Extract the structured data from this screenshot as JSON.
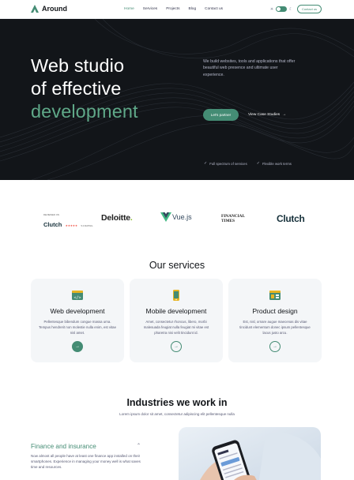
{
  "nav": {
    "logo": "Around",
    "items": [
      "Home",
      "Services",
      "Projects",
      "Blog",
      "Contact us"
    ],
    "active_index": 0,
    "contact_button": "Contact us",
    "theme_toggle_on": true
  },
  "hero": {
    "title_line1": "Web studio",
    "title_line2": "of effective",
    "title_accent": "development",
    "description": "We build websites, tools and applications that offer beautiful web presence and ultimate user experience.",
    "primary_button": "Let's partner",
    "secondary_link": "View Case Studies",
    "features": [
      "Full spectrum of services",
      "Flexible work terms"
    ]
  },
  "clients": {
    "clutch_small_reviewed": "REVIEWED ON",
    "clutch_small_name": "Clutch",
    "clutch_small_rating": "5.0 RATING",
    "clutch_small_stars": "★★★★★",
    "deloitte": "Deloitte",
    "deloitte_dot": ".",
    "vue": "Vue.js",
    "ft_line1": "FINANCIAL",
    "ft_line2": "TIMES",
    "clutch_big": "Clutch"
  },
  "services": {
    "title": "Our services",
    "cards": [
      {
        "title": "Web development",
        "text": "Pellentesque bibendum congue massa urna. Tempus hendrerit non molestie nulla enim, est vitae nisl amet."
      },
      {
        "title": "Mobile development",
        "text": "Amet, consectetur rhoncus, libero, morbi malesuada feugiat nulla feugiat mi vitae est pharetra nisi velit tincidunt id."
      },
      {
        "title": "Product design",
        "text": "Est, nisl, ornare augue maecenas dis vitae tincidunt elementum donec ipsum pellentesque lacus justo arcu."
      }
    ]
  },
  "industries": {
    "title": "Industries we work in",
    "subtitle": "Lorem ipsum dolor sit amet, consectetur adipiscing elit pellentesque nulla",
    "accordion_title": "Finance and insurance",
    "accordion_text": "Now almost all people have at least one finance app installed on their smartphones. Experience in managing your money well is what saves time and resources."
  },
  "colors": {
    "accent": "#448c74",
    "hero_bg": "#121519",
    "card_bg": "#f4f6f8"
  },
  "icons": [
    "around-logo-icon",
    "sun-icon",
    "arrow-right-icon",
    "check-icon",
    "code-window-icon",
    "mobile-icon",
    "design-window-icon",
    "chevron-up-icon"
  ]
}
